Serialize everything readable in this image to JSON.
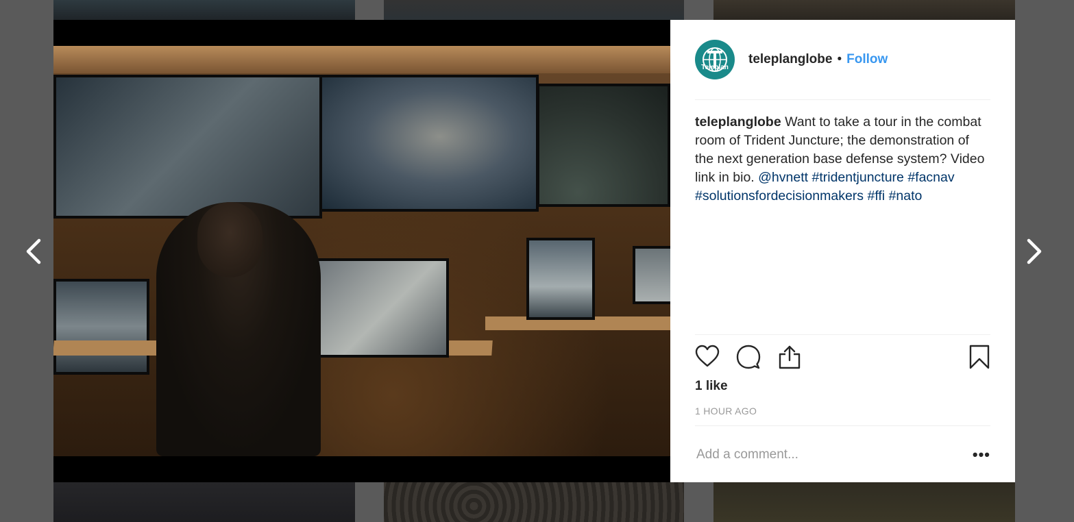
{
  "post": {
    "username": "teleplanglobe",
    "follow_label": "Follow",
    "separator": "•",
    "avatar": {
      "text": "Teleplan",
      "icon": "globe-logo-icon",
      "color": "#1a8a8a"
    },
    "caption": {
      "username": "teleplanglobe",
      "text": "Want to take a tour in the combat room of Trident Juncture; the demonstration of the next generation base defense system? Video link in bio.",
      "mention": "@hvnett",
      "hashtags": [
        "#tridentjuncture",
        "#facnav",
        "#solutionsfordecisionmakers",
        "#ffi",
        "#nato"
      ]
    },
    "likes": "1 like",
    "time_ago": "1 HOUR AGO",
    "comment_placeholder": "Add a comment...",
    "more_label": "•••"
  },
  "actions": {
    "like_icon": "heart-icon",
    "comment_icon": "comment-icon",
    "share_icon": "share-icon",
    "save_icon": "bookmark-icon"
  },
  "nav": {
    "prev_icon": "chevron-left-icon",
    "next_icon": "chevron-right-icon"
  },
  "colors": {
    "link": "#003569",
    "follow": "#3897f0",
    "overlay": "#5a5a5a"
  }
}
